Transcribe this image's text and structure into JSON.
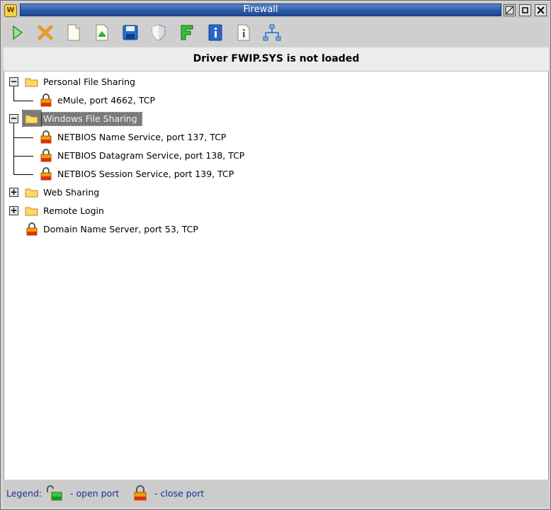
{
  "window": {
    "title": "Firewall",
    "app_icon": "firewall-app-icon",
    "controls": [
      "resize-icon",
      "restore-icon",
      "close-icon"
    ]
  },
  "toolbar": {
    "buttons": [
      {
        "name": "start-button",
        "icon": "play-icon"
      },
      {
        "name": "stop-button",
        "icon": "cross-icon"
      },
      {
        "name": "new-button",
        "icon": "new-document-icon"
      },
      {
        "name": "open-button",
        "icon": "open-icon"
      },
      {
        "name": "save-button",
        "icon": "floppy-disk-icon"
      },
      {
        "name": "shield-button",
        "icon": "shield-icon"
      },
      {
        "name": "fwip-button",
        "icon": "f-letter-icon"
      },
      {
        "name": "info-button",
        "icon": "info-icon"
      },
      {
        "name": "document-info-button",
        "icon": "document-info-icon"
      },
      {
        "name": "network-button",
        "icon": "network-icon"
      }
    ]
  },
  "status": {
    "message": "Driver FWIP.SYS is not loaded"
  },
  "tree": {
    "groups": [
      {
        "label": "Personal File Sharing",
        "expanded": true,
        "children": [
          "eMule, port 4662, TCP"
        ]
      },
      {
        "label": "Windows File Sharing",
        "expanded": true,
        "selected": true,
        "children": [
          "NETBIOS Name Service, port 137, TCP",
          "NETBIOS Datagram Service, port 138, TCP",
          "NETBIOS Session Service, port 139, TCP"
        ]
      },
      {
        "label": "Web Sharing",
        "expanded": false
      },
      {
        "label": "Remote Login",
        "expanded": false
      }
    ],
    "standalone": [
      "Domain Name Server, port 53, TCP"
    ]
  },
  "legend": {
    "label": "Legend:",
    "open_port": "-  open port",
    "close_port": "-  close port"
  },
  "colors": {
    "title_bar": "#2d5aa8",
    "selection": "#7a7a7a",
    "legend_text": "#1a2f8a",
    "lock_closed": "#f0a000",
    "lock_open": "#22aa22"
  }
}
